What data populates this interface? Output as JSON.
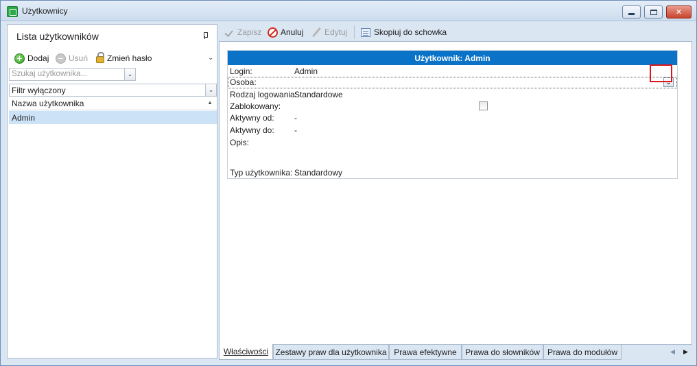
{
  "window": {
    "title": "Użytkownicy"
  },
  "left_panel": {
    "title": "Lista użytkowników",
    "toolbar": {
      "add_label": "Dodaj",
      "remove_label": "Usuń",
      "change_password_label": "Zmień hasło"
    },
    "search": {
      "placeholder": "Szukaj użytkownika..."
    },
    "filter": {
      "value": "Filtr wyłączony"
    },
    "list": {
      "column_header": "Nazwa użytkownika",
      "rows": [
        "Admin"
      ]
    }
  },
  "right_toolbar": {
    "save_label": "Zapisz",
    "cancel_label": "Anuluj",
    "edit_label": "Edytuj",
    "copy_label": "Skopiuj do schowka"
  },
  "form": {
    "header": "Użytkownik: Admin",
    "fields": {
      "login": {
        "label": "Login:",
        "value": "Admin"
      },
      "person": {
        "label": "Osoba:",
        "value": ""
      },
      "login_type": {
        "label": "Rodzaj logowania:",
        "value": "Standardowe"
      },
      "blocked": {
        "label": "Zablokowany:",
        "checked": false
      },
      "active_from": {
        "label": "Aktywny od:",
        "value": "-"
      },
      "active_to": {
        "label": "Aktywny do:",
        "value": "-"
      },
      "description": {
        "label": "Opis:",
        "value": ""
      },
      "user_type": {
        "label": "Typ użytkownika:",
        "value": "Standardowy"
      }
    }
  },
  "tabs": [
    {
      "label": "Właściwości",
      "active": true
    },
    {
      "label": "Zestawy praw dla użytkownika",
      "active": false
    },
    {
      "label": "Prawa efektywne",
      "active": false
    },
    {
      "label": "Prawa do słowników",
      "active": false
    },
    {
      "label": "Prawa do modułów",
      "active": false
    }
  ],
  "colors": {
    "accent": "#0a73c7",
    "highlight": "#e0141b",
    "selection": "#cce2f6"
  }
}
